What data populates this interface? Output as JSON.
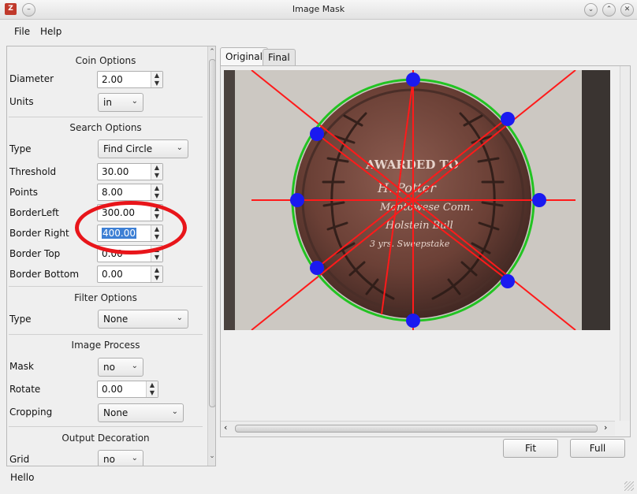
{
  "window": {
    "title": "Image Mask",
    "app_icon": "Z"
  },
  "menu": {
    "file": "File",
    "help": "Help"
  },
  "coin_options": {
    "header": "Coin Options",
    "diameter_label": "Diameter",
    "diameter_value": "2.00",
    "units_label": "Units",
    "units_value": "in"
  },
  "search_options": {
    "header": "Search Options",
    "type_label": "Type",
    "type_value": "Find Circle",
    "threshold_label": "Threshold",
    "threshold_value": "30.00",
    "points_label": "Points",
    "points_value": "8.00",
    "border_left_label": "BorderLeft",
    "border_left_value": "300.00",
    "border_right_label": "Border Right",
    "border_right_value": "400.00",
    "border_top_label": "Border Top",
    "border_top_value": "0.00",
    "border_bottom_label": "Border Bottom",
    "border_bottom_value": "0.00"
  },
  "filter_options": {
    "header": "Filter Options",
    "type_label": "Type",
    "type_value": "None"
  },
  "image_process": {
    "header": "Image Process",
    "mask_label": "Mask",
    "mask_value": "no",
    "rotate_label": "Rotate",
    "rotate_value": "0.00",
    "cropping_label": "Cropping",
    "cropping_value": "None"
  },
  "output_decoration": {
    "header": "Output Decoration",
    "grid_label": "Grid",
    "grid_value": "no"
  },
  "tabs": {
    "original": "Original",
    "final": "Final"
  },
  "coin_text": {
    "line1": "AWARDED TO",
    "line2": "H. Potter",
    "line3": "Montowese Conn.",
    "line4": "Holstein Bull",
    "line5": "3 yrs. Sweepstake"
  },
  "buttons": {
    "fit": "Fit",
    "full": "Full"
  },
  "status": {
    "text": "Hello"
  },
  "colors": {
    "circle": "#22c322",
    "lines": "#ff1a1a",
    "points": "#1a1af0",
    "highlight": "#e8151a"
  }
}
